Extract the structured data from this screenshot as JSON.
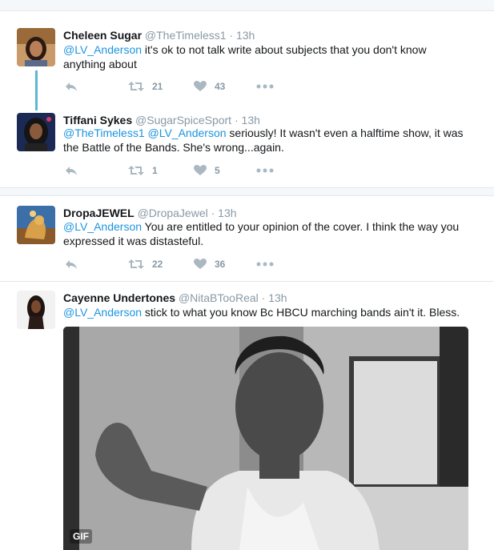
{
  "tweets": [
    {
      "name": "Cheleen Sugar",
      "handle": "@TheTimeless1",
      "dot": "·",
      "time": "13h",
      "mentions": "@LV_Anderson",
      "text": " it's ok to not talk write about subjects that you don't know anything about",
      "retweets": "21",
      "likes": "43"
    },
    {
      "name": "Tiffani Sykes",
      "handle": "@SugarSpiceSport",
      "dot": "·",
      "time": "13h",
      "mentions": "@TheTimeless1 @LV_Anderson",
      "text": " seriously! It wasn't even a halftime show, it was the Battle of the Bands. She's wrong...again.",
      "retweets": "1",
      "likes": "5"
    },
    {
      "name": "DropaJEWEL",
      "handle": "@DropaJewel",
      "dot": "·",
      "time": "13h",
      "mentions": "@LV_Anderson",
      "text": " You are entitled to your opinion of the cover. I think the way you expressed it was distasteful.",
      "retweets": "22",
      "likes": "36"
    },
    {
      "name": "Cayenne Undertones",
      "handle": "@NitaBTooReal",
      "dot": "·",
      "time": "13h",
      "mentions": "@LV_Anderson",
      "text": " stick to what you know Bc HBCU marching bands ain't it. Bless.",
      "media_badge": "GIF"
    }
  ],
  "icons": {
    "reply": "reply-icon",
    "retweet": "retweet-icon",
    "like": "heart-icon",
    "more": "more-icon"
  },
  "colors": {
    "link": "#1b95e0",
    "meta": "#8899a6",
    "thread": "#5cb8d4"
  }
}
